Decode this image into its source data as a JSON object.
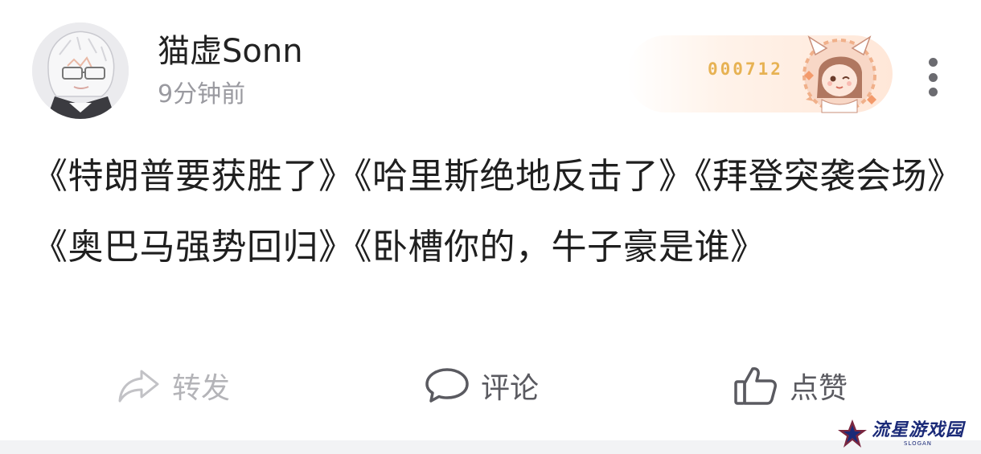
{
  "post": {
    "author": {
      "username": "猫虚Sonn",
      "timestamp": "9分钟前",
      "avatar_icon": "anime-avatar-icon"
    },
    "fan_badge": {
      "number": "000712",
      "icon": "anime-girl-badge-icon",
      "accent_color": "#e7b253"
    },
    "more_icon": "more-vertical-icon",
    "content": "《特朗普要获胜了》《哈里斯绝地反击了》《拜登突袭会场》《奥巴马强势回归》《卧槽你的，牛子豪是谁》",
    "actions": {
      "share_label": "转发",
      "share_icon": "share-arrow-icon",
      "comment_label": "评论",
      "comment_icon": "comment-bubble-icon",
      "like_label": "点赞",
      "like_icon": "thumbs-up-icon"
    }
  },
  "watermark": {
    "main": "流星游戏园",
    "sub": "SLOGAN"
  }
}
